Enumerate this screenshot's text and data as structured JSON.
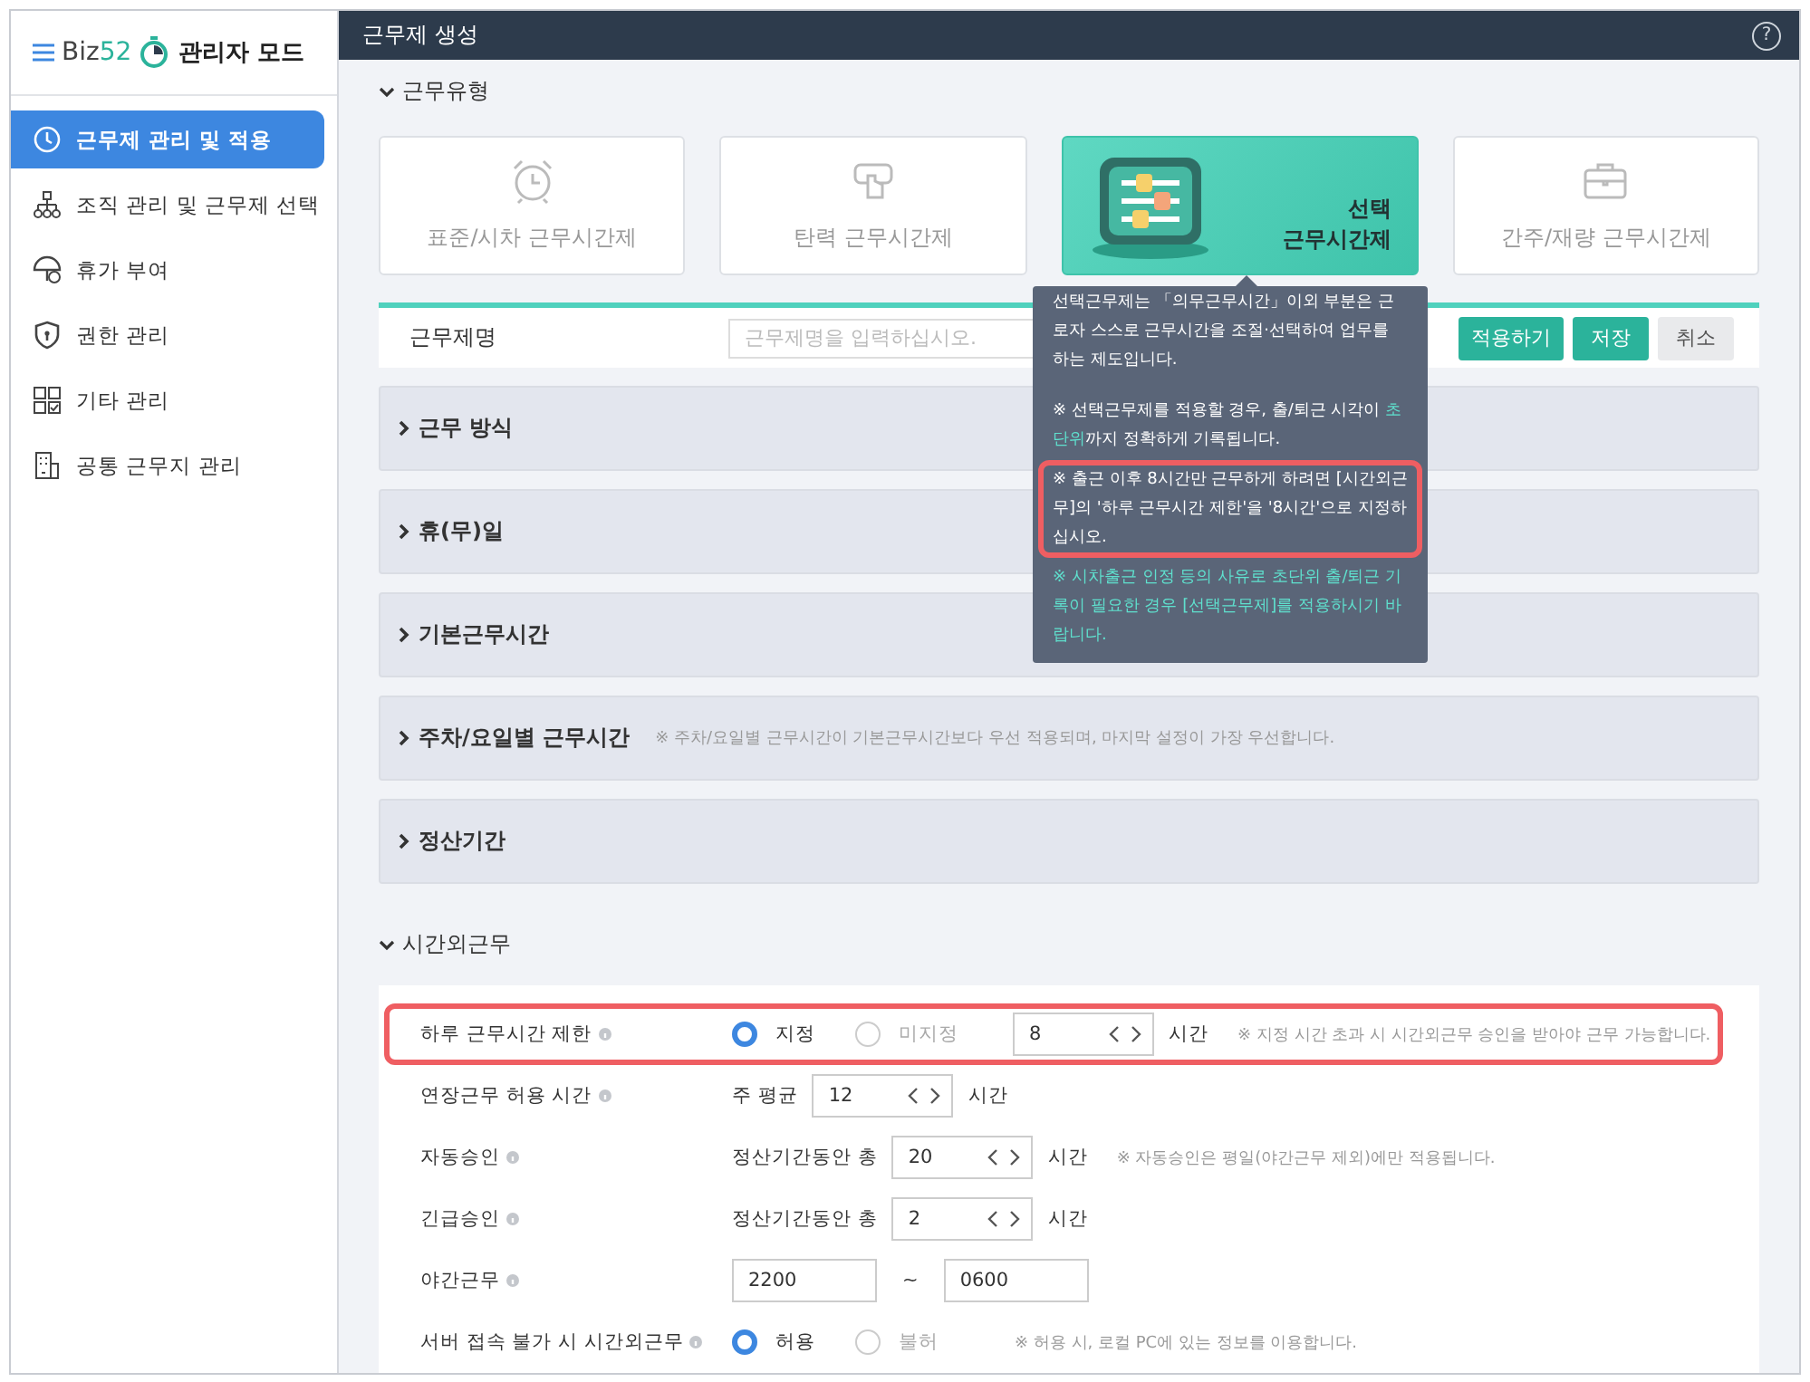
{
  "window": {
    "title": "근무제 생성",
    "help": "?"
  },
  "sidebar": {
    "brand": "Biz",
    "brand_accent": "52",
    "mode": "관리자 모드",
    "items": [
      {
        "label": "근무제 관리 및 적용",
        "selected": true
      },
      {
        "label": "조직 관리 및 근무제 선택",
        "selected": false
      },
      {
        "label": "휴가 부여",
        "selected": false
      },
      {
        "label": "권한 관리",
        "selected": false
      },
      {
        "label": "기타 관리",
        "selected": false
      },
      {
        "label": "공통 근무지 관리",
        "selected": false
      }
    ]
  },
  "work_type": {
    "title": "근무유형",
    "expanded": true,
    "cards": [
      {
        "label": "표준/시차 근무시간제",
        "selected": false
      },
      {
        "label": "탄력 근무시간제",
        "selected": false
      },
      {
        "label": "선택\n근무시간제",
        "selected": true
      },
      {
        "label": "간주/재량 근무시간제",
        "selected": false
      }
    ]
  },
  "name_row": {
    "label": "근무제명",
    "placeholder": "근무제명을 입력하십시오.",
    "buttons": [
      {
        "label": "적용하기",
        "kind": "apply"
      },
      {
        "label": "저장",
        "kind": "primary"
      },
      {
        "label": "취소",
        "kind": "cancel"
      }
    ]
  },
  "tooltip": {
    "lines": [
      {
        "text": "선택근무제는 「의무근무시간」이외 부분은 근로자 스스로 근무시간을 조절·선택하여 업무를 하는 제도입니다.",
        "kind": "plain",
        "highlighted": false
      },
      {
        "text": "※ 선택근무제를 적용할 경우, 출/퇴근 시각이 **초단위**까지 정확하게 기록됩니다.",
        "kind": "plain",
        "highlighted": false
      },
      {
        "text": "※ 출근 이후 8시간만 근무하게 하려면 [시간외근무]의 '하루 근무시간 제한'을 '8시간'으로 지정하십시오.",
        "kind": "plain",
        "highlighted": true
      },
      {
        "text": "※ 시차출근 인정 등의 사유로 초단위 출/퇴근 기록이 필요한 경우 [선택근무제]를 적용하시기 바랍니다.",
        "kind": "accent",
        "highlighted": false
      }
    ]
  },
  "sections": [
    {
      "label": "근무 방식",
      "expanded": false
    },
    {
      "label": "휴(무)일",
      "expanded": false
    },
    {
      "label": "기본근무시간",
      "expanded": false
    },
    {
      "label": "주차/요일별 근무시간",
      "expanded": false,
      "note": "※ 주차/요일별 근무시간이 기본근무시간보다 우선 적용되며, 마지막 설정이 가장 우선합니다."
    },
    {
      "label": "정산기간",
      "expanded": false
    }
  ],
  "overtime": {
    "title": "시간외근무",
    "expanded": true,
    "rows": [
      {
        "kind": "radio_number",
        "label": "하루 근무시간 제한",
        "highlighted": true,
        "options": [
          {
            "label": "지정",
            "selected": true
          },
          {
            "label": "미지정",
            "selected": false
          }
        ],
        "value": "8",
        "unit": "시간",
        "note": "※ 지정 시간 초과 시 시간외근무 승인을 받아야 근무 가능합니다."
      },
      {
        "kind": "number",
        "label": "연장근무 허용 시간",
        "highlighted": false,
        "prefix": "주 평균",
        "value": "12",
        "unit": "시간"
      },
      {
        "kind": "number",
        "label": "자동승인",
        "highlighted": false,
        "prefix": "정산기간동안 총",
        "value": "20",
        "unit": "시간",
        "note": "※ 자동승인은 평일(야간근무 제외)에만 적용됩니다."
      },
      {
        "kind": "number",
        "label": "긴급승인",
        "highlighted": false,
        "prefix": "정산기간동안 총",
        "value": "2",
        "unit": "시간"
      },
      {
        "kind": "range",
        "label": "야간근무",
        "highlighted": false,
        "from": "2200",
        "separator": "~",
        "to": "0600"
      },
      {
        "kind": "radio",
        "label": "서버 접속 불가 시 시간외근무",
        "highlighted": false,
        "options": [
          {
            "label": "허용",
            "selected": true
          },
          {
            "label": "불허",
            "selected": false
          }
        ],
        "note": "※ 허용 시, 로컬 PC에 있는 정보를 이용합니다."
      }
    ]
  }
}
